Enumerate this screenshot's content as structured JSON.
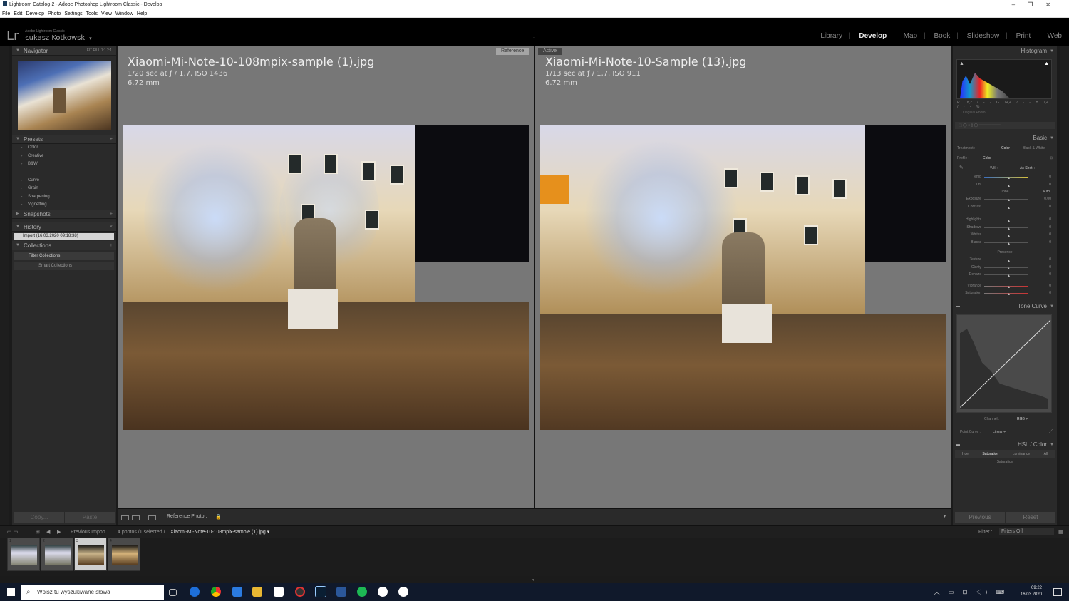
{
  "window": {
    "title": "Lightroom Catalog-2 - Adobe Photoshop Lightroom Classic - Develop",
    "controls": [
      "–",
      "❐",
      "✕"
    ]
  },
  "menu": [
    "File",
    "Edit",
    "Develop",
    "Photo",
    "Settings",
    "Tools",
    "View",
    "Window",
    "Help"
  ],
  "identity": {
    "logo": "Lr",
    "product": "Adobe Lightroom Classic",
    "user": "Łukasz Kotkowski",
    "caret": "▾"
  },
  "modules": [
    "Library",
    "Develop",
    "Map",
    "Book",
    "Slideshow",
    "Print",
    "Web"
  ],
  "active_module": "Develop",
  "left": {
    "navigator": {
      "title": "Navigator",
      "zoom": "FIT   FILL   1:1   2:1"
    },
    "presets": {
      "title": "Presets",
      "items": [
        "Color",
        "Creative",
        "B&W",
        "Curve",
        "Grain",
        "Sharpening",
        "Vignetting"
      ]
    },
    "snapshots": {
      "title": "Snapshots"
    },
    "history": {
      "title": "History",
      "item": "Import (16.03.2020 09:18:38)"
    },
    "collections": {
      "title": "Collections",
      "items": [
        "Filter Collections",
        "Smart Collections"
      ]
    },
    "copy": "Copy...",
    "paste": "Paste"
  },
  "compare": {
    "left": {
      "badge": "Reference",
      "title": "Xiaomi-Mi-Note-10-108mpix-sample (1).jpg",
      "exposure": "1/20 sec at ƒ / 1,7, ISO 1436",
      "focal": "6.72 mm"
    },
    "right": {
      "badge": "Active",
      "title": "Xiaomi-Mi-Note-10-Sample (13).jpg",
      "exposure": "1/13 sec at ƒ / 1,7, ISO 911",
      "focal": "6.72 mm"
    }
  },
  "toolbar": {
    "reference_label": "Reference Photo :",
    "loupe_icon": "loupe-view-icon",
    "compare_icon": "before-after-icon"
  },
  "right": {
    "histogram": {
      "title": "Histogram",
      "r": "R  18,2 / - -",
      "g": "G  14,4 / - -",
      "b": "B  7,4 / - -",
      "pct": "%",
      "original": "Original Photo"
    },
    "basic": {
      "title": "Basic",
      "treatment_label": "Treatment :",
      "color": "Color",
      "bw": "Black & White",
      "profile_label": "Profile :",
      "profile_value": "Color ÷",
      "wb_label": "WB :",
      "wb_value": "As Shot ÷",
      "tone_label": "Tone",
      "auto": "Auto",
      "presence_label": "Presence",
      "sliders": [
        {
          "label": "Temp",
          "value": "0"
        },
        {
          "label": "Tint",
          "value": "0"
        },
        {
          "label": "Exposure",
          "value": "0,00"
        },
        {
          "label": "Contrast",
          "value": "0"
        },
        {
          "label": "Highlights",
          "value": "0"
        },
        {
          "label": "Shadows",
          "value": "0"
        },
        {
          "label": "Whites",
          "value": "0"
        },
        {
          "label": "Blacks",
          "value": "0"
        },
        {
          "label": "Texture",
          "value": "0"
        },
        {
          "label": "Clarity",
          "value": "0"
        },
        {
          "label": "Dehaze",
          "value": "0"
        },
        {
          "label": "Vibrance",
          "value": "0"
        },
        {
          "label": "Saturation",
          "value": "0"
        }
      ]
    },
    "tonecurve": {
      "title": "Tone Curve",
      "channel_label": "Channel :",
      "channel_value": "RGB ÷",
      "point_label": "Point Curve :",
      "point_value": "Linear ÷"
    },
    "hsl": {
      "title": "HSL / Color",
      "tabs": [
        "Hue",
        "Saturation",
        "Luminance",
        "All"
      ],
      "sub": "Saturation"
    },
    "previous": "Previous",
    "reset": "Reset"
  },
  "filmbar": {
    "source": "Previous Import",
    "count": "4 photos /1 selected /",
    "file": "Xiaomi-Mi-Note-10-108mpix-sample (1).jpg ▾",
    "filter_label": "Filter :",
    "filter_value": "Filters Off"
  },
  "filmstrip": [
    "1",
    "2",
    "3",
    "4"
  ],
  "taskbar": {
    "search": "Wpisz tu wyszukiwane słowa",
    "time": "09:22",
    "date": "16.03.2020",
    "tray": "︿ ▭ ⊡ ◁) ⌨"
  }
}
